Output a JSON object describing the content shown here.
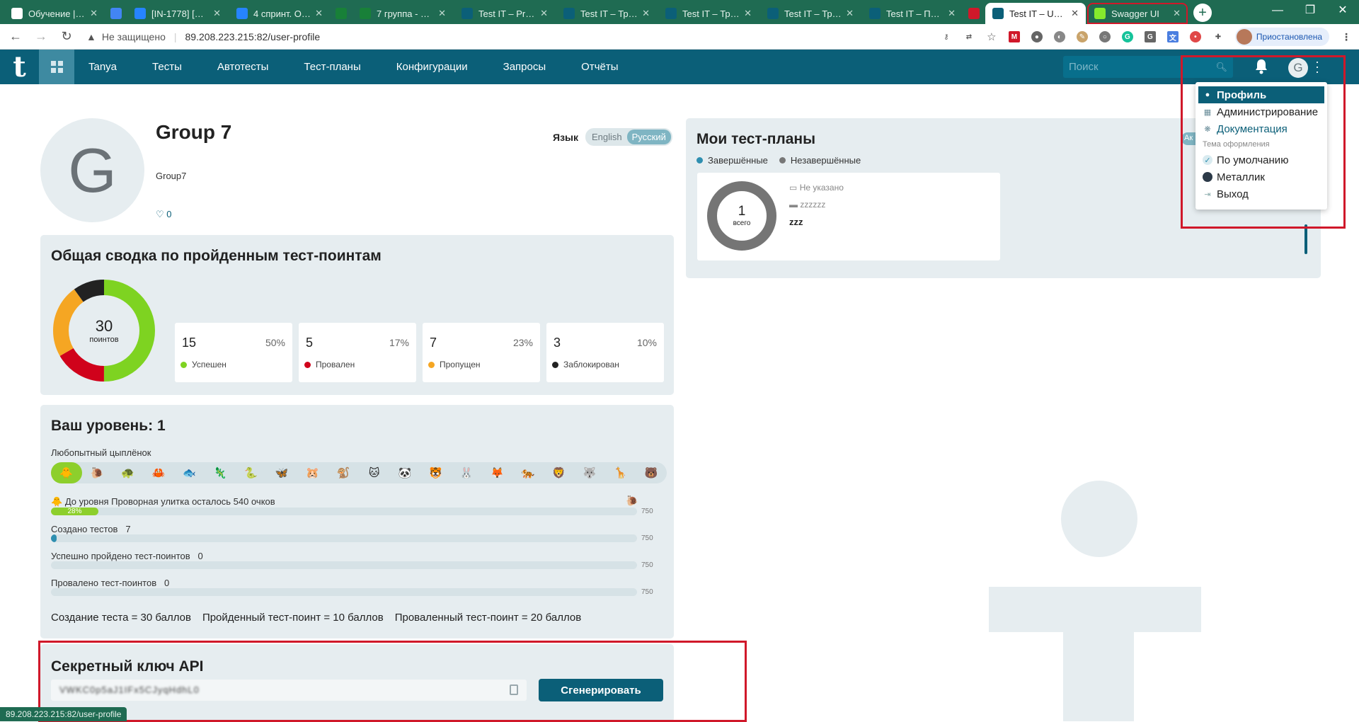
{
  "browser": {
    "tabs": [
      {
        "title": "Обучение | Ge",
        "color": "#fff"
      },
      {
        "title": "",
        "color": "#4285f4"
      },
      {
        "title": "[IN-1778] [Зап",
        "color": "#2684ff"
      },
      {
        "title": "4 спринт. Обр",
        "color": "#2684ff"
      },
      {
        "title": "",
        "color": "#188038"
      },
      {
        "title": "7 группа - Goo",
        "color": "#188038"
      },
      {
        "title": "Test IT – Projec",
        "color": "#0b5f78"
      },
      {
        "title": "Test IT – Требо",
        "color": "#0b5f78"
      },
      {
        "title": "Test IT – Требо",
        "color": "#0b5f78"
      },
      {
        "title": "Test IT – Требо",
        "color": "#0b5f78"
      },
      {
        "title": "Test IT – Получ",
        "color": "#0b5f78"
      },
      {
        "title": "",
        "color": "#d0182a"
      },
      {
        "title": "Test IT – User p",
        "color": "#0b5f78"
      },
      {
        "title": "Swagger UI",
        "color": "#85ea2d"
      }
    ],
    "not_secure": "Не защищено",
    "url": "89.208.223.215:82/user-profile",
    "profile_label": "Приостановлена",
    "status_url": "89.208.223.215:82/user-profile"
  },
  "nav": {
    "logo": "t",
    "links": [
      "Tanya",
      "Тесты",
      "Автотесты",
      "Тест-планы",
      "Конфигурации",
      "Запросы",
      "Отчёты"
    ],
    "search_placeholder": "Поиск",
    "avatar_letter": "G"
  },
  "user": {
    "avatar_letter": "G",
    "name": "Group 7",
    "login": "Group7",
    "likes": "0",
    "lang_label": "Язык",
    "lang_en": "English",
    "lang_ru": "Русский"
  },
  "summary": {
    "title": "Общая сводка по пройденным тест-поинтам",
    "total": "30",
    "total_label": "поинтов",
    "stats": [
      {
        "value": "15",
        "percent": "50%",
        "label": "Успешен",
        "color": "#7ed321"
      },
      {
        "value": "5",
        "percent": "17%",
        "label": "Провален",
        "color": "#d0021b"
      },
      {
        "value": "7",
        "percent": "23%",
        "label": "Пропущен",
        "color": "#f5a623"
      },
      {
        "value": "3",
        "percent": "10%",
        "label": "Заблокирован",
        "color": "#222222"
      }
    ]
  },
  "level": {
    "title": "Ваш уровень: 1",
    "rank": "Любопытный цыплёнок",
    "animals": [
      "🐥",
      "🐌",
      "🐢",
      "🦀",
      "🐟",
      "🦎",
      "🐍",
      "🦋",
      "🐹",
      "🐒",
      "🐱",
      "🐼",
      "🐯",
      "🐰",
      "🦊",
      "🐅",
      "🦁",
      "🐺",
      "🦒",
      "🐻"
    ],
    "next_text": "До уровня Проворная улитка осталось 540 очков",
    "progress": {
      "label": "28%",
      "value": 28
    },
    "bars": [
      {
        "label": "Создано тестов",
        "value": "7",
        "fill": 1,
        "max": "750"
      },
      {
        "label": "Успешно пройдено тест-поинтов",
        "value": "0",
        "fill": 0,
        "max": "750"
      },
      {
        "label": "Провалено тест-поинтов",
        "value": "0",
        "fill": 0,
        "max": "750"
      }
    ],
    "progress_max": "750",
    "points": [
      "Создание теста = 30 баллов",
      "Пройденный тест-поинт = 10 баллов",
      "Проваленный тест-поинт = 20 баллов"
    ]
  },
  "api": {
    "title": "Секретный ключ API",
    "key": "VWKC0p5aJ1IFx5CJyqHdhL0",
    "button": "Сгенерировать"
  },
  "plans": {
    "title": "Мои тест-планы",
    "legend_done": "Завершённые",
    "legend_open": "Незавершённые",
    "count": "1",
    "count_label": "всего",
    "date": "Не указано",
    "project": "zzzzzz",
    "name": "zzz",
    "active_badge": "Ак"
  },
  "menu": {
    "profile": "Профиль",
    "admin": "Администрирование",
    "docs": "Документация",
    "theme_label": "Тема оформления",
    "theme_default": "По умолчанию",
    "theme_metal": "Металлик",
    "logout": "Выход"
  }
}
